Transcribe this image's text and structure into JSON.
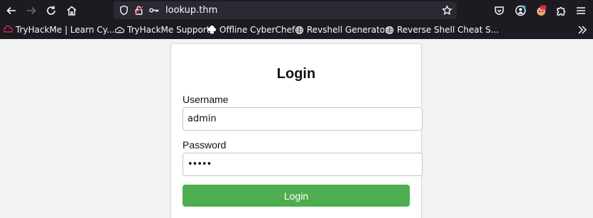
{
  "browser": {
    "url": "lookup.thm",
    "bookmarks": [
      {
        "label": "TryHackMe | Learn Cy...",
        "icon": "tryhackme-icon"
      },
      {
        "label": "TryHackMe Support",
        "icon": "cloud-icon"
      },
      {
        "label": "Offline CyberChef",
        "icon": "chef-icon"
      },
      {
        "label": "Revshell Generator",
        "icon": "globe-icon"
      },
      {
        "label": "Reverse Shell Cheat S...",
        "icon": "globe-icon"
      }
    ],
    "colors": {
      "chrome": "#1c1b22",
      "urlbar": "#2b2a33",
      "text": "#fbfbfe"
    }
  },
  "login": {
    "title": "Login",
    "username_label": "Username",
    "username_value": "admin",
    "password_label": "Password",
    "password_value": "•••••",
    "submit_label": "Login",
    "colors": {
      "button": "#4cae4f",
      "page_bg": "#f2f2f2"
    }
  }
}
